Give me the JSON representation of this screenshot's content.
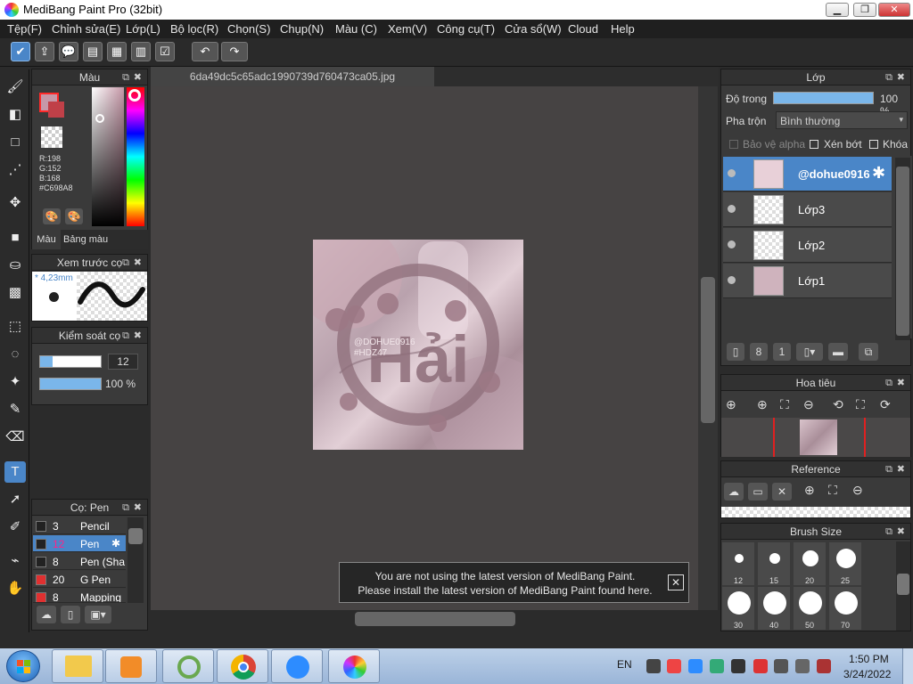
{
  "window": {
    "title": "MediBang Paint Pro (32bit)",
    "minimize": "▁",
    "maximize": "❐",
    "close": "✕"
  },
  "menu": [
    "Tệp(F)",
    "Chỉnh sửa(E)",
    "Lớp(L)",
    "Bộ lọc(R)",
    "Chọn(S)",
    "Chụp(N)",
    "Màu (C)",
    "Xem(V)",
    "Công cụ(T)",
    "Cửa sổ(W)",
    "Cloud",
    "Help"
  ],
  "toolbar": {
    "undo": "↶",
    "redo": "↷"
  },
  "document": {
    "tab": "6da49dc5c65adc1990739d760473ca05.jpg"
  },
  "canvas_art": {
    "title": "Hải",
    "watermark_1": "@DOHUE0916",
    "watermark_2": "#HDZ47"
  },
  "color_panel": {
    "title": "Màu",
    "r": "R:198",
    "g": "G:152",
    "b": "B:168",
    "hex": "#C698A8",
    "tab_color": "Màu",
    "tab_palette": "Bảng màu",
    "fg_color": "#c698a8",
    "accent": "#ff2a2a"
  },
  "brush_preview": {
    "title": "Xem trước cọ",
    "size": "* 4,23mm"
  },
  "brush_control": {
    "title": "Kiểm soát cọ",
    "size": "12",
    "opacity": "100 %",
    "size_fraction": 0.2,
    "opacity_fraction": 1.0
  },
  "brush_list": {
    "title": "Cọ: Pen",
    "items": [
      {
        "n": "3",
        "label": "Pencil",
        "swatch": "#222222"
      },
      {
        "n": "12",
        "label": "Pen",
        "swatch": "#222222"
      },
      {
        "n": "8",
        "label": "Pen (Sha",
        "swatch": "#222222"
      },
      {
        "n": "20",
        "label": "G Pen",
        "swatch": "#e03030"
      },
      {
        "n": "8",
        "label": "Mapping",
        "swatch": "#e03030"
      }
    ]
  },
  "layer_panel": {
    "title": "Lớp",
    "opacity_label": "Độ trong",
    "opacity_value": "100 %",
    "opacity_fraction": 1.0,
    "blend_label": "Pha trộn",
    "blend_value": "Bình thường",
    "protect_alpha": "Bảo vệ alpha",
    "clipping": "Xén bớt",
    "lock": "Khóa",
    "layers": [
      {
        "name": "@dohue0916",
        "selected": true
      },
      {
        "name": "Lớp3",
        "selected": false
      },
      {
        "name": "Lớp2",
        "selected": false
      },
      {
        "name": "Lớp1",
        "selected": false
      }
    ]
  },
  "navigator": {
    "title": "Hoa tiêu"
  },
  "reference": {
    "title": "Reference"
  },
  "brush_size": {
    "title": "Brush Size",
    "sizes": [
      "12",
      "15",
      "20",
      "25",
      "30",
      "40",
      "50",
      "70"
    ]
  },
  "notice": {
    "line1": "You are not using the latest version of MediBang Paint.",
    "line2": "Please install the latest version of MediBang Paint found here.",
    "close": "✕"
  },
  "taskbar": {
    "language": "EN",
    "time": "1:50 PM",
    "date": "3/24/2022"
  }
}
